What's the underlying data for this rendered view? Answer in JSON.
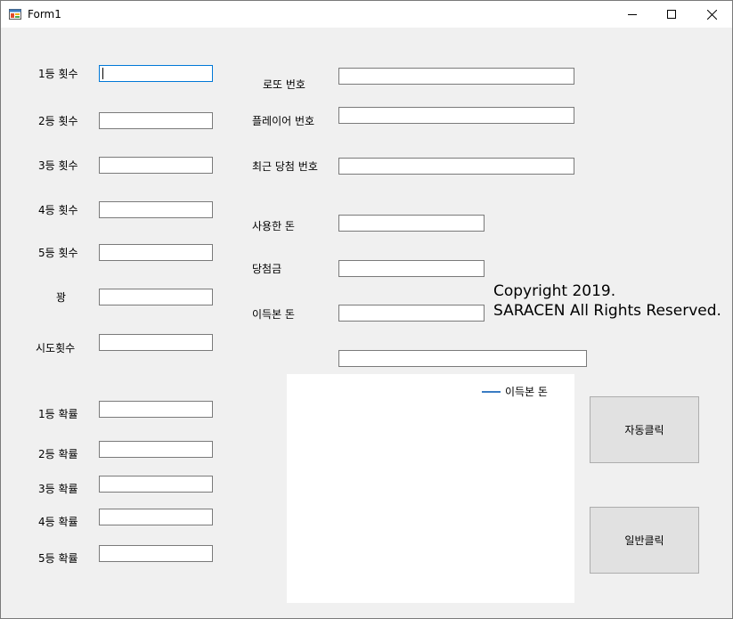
{
  "window": {
    "title": "Form1"
  },
  "left_labels": {
    "rank1_count": "1등 횟수",
    "rank2_count": "2등 횟수",
    "rank3_count": "3등 횟수",
    "rank4_count": "4등 횟수",
    "rank5_count": "5등 횟수",
    "miss_count": "꽝",
    "try_count": "시도횟수",
    "rank1_prob": "1등 확률",
    "rank2_prob": "2등 확률",
    "rank3_prob": "3등 확률",
    "rank4_prob": "4등 확률",
    "rank5_prob": "5등 확률"
  },
  "left_values": {
    "rank1_count": "",
    "rank2_count": "",
    "rank3_count": "",
    "rank4_count": "",
    "rank5_count": "",
    "miss_count": "",
    "try_count": "",
    "rank1_prob": "",
    "rank2_prob": "",
    "rank3_prob": "",
    "rank4_prob": "",
    "rank5_prob": ""
  },
  "mid_labels": {
    "lotto_number": "로또 번호",
    "player_number": "플레이어 번호",
    "recent_winning_number": "최근 당첨 번호",
    "money_used": "사용한 돈",
    "prize_money": "당첨금",
    "profit": "이득본 돈"
  },
  "mid_values": {
    "lotto_number": "",
    "player_number": "",
    "recent_winning_number": "",
    "money_used": "",
    "prize_money": "",
    "profit": "",
    "extra": ""
  },
  "copyright": {
    "line1": "Copyright 2019.",
    "line2": "SARACEN All Rights Reserved."
  },
  "chart_data": {
    "type": "line",
    "series": [
      {
        "name": "이득본 돈",
        "values": []
      }
    ],
    "legend_placement": "top-right",
    "grid": false,
    "colors": {
      "series": "#3a7cc3"
    }
  },
  "buttons": {
    "auto_click": "자동클릭",
    "normal_click": "일반클릭"
  }
}
